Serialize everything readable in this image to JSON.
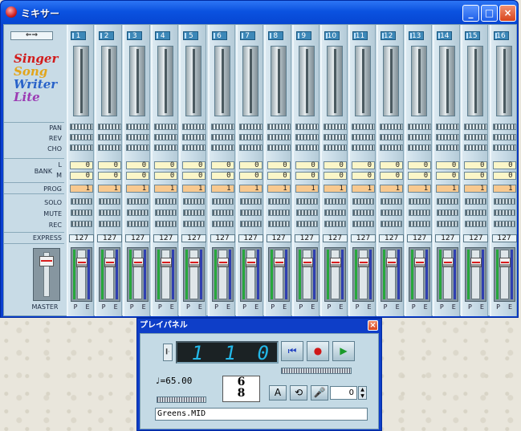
{
  "mixer": {
    "title": "ミキサー",
    "window_buttons": [
      "_",
      "□",
      "×"
    ],
    "channels": [
      "1",
      "2",
      "3",
      "4",
      "5",
      "6",
      "7",
      "8",
      "9",
      "10",
      "11",
      "12",
      "13",
      "14",
      "15",
      "16"
    ],
    "logo": [
      "Singer",
      "Song",
      "Writer",
      "Lite"
    ],
    "logo_colors": [
      "#d21b1b",
      "#e2a51b",
      "#2a63c9",
      "#9b3bb3"
    ],
    "labels": {
      "pan": "PAN",
      "rev": "REV",
      "cho": "CHO",
      "bank": "BANK",
      "bank_l": "L",
      "bank_m": "M",
      "prog": "PROG",
      "solo": "SOLO",
      "mute": "MUTE",
      "rec": "REC",
      "express": "EXPRESS",
      "master": "MASTER",
      "p": "P",
      "e": "E"
    },
    "bank_l": "0",
    "bank_m": "0",
    "prog": "1",
    "express": "127"
  },
  "play": {
    "title": "プレイパネル",
    "close": "×",
    "counter": "1 1 0",
    "tempo": "♩=65.00",
    "meter_top": "6",
    "meter_bottom": "8",
    "transpose": "0",
    "file": "Greens.MID",
    "icons": [
      "rewind-icon",
      "record-icon",
      "play-icon"
    ]
  }
}
